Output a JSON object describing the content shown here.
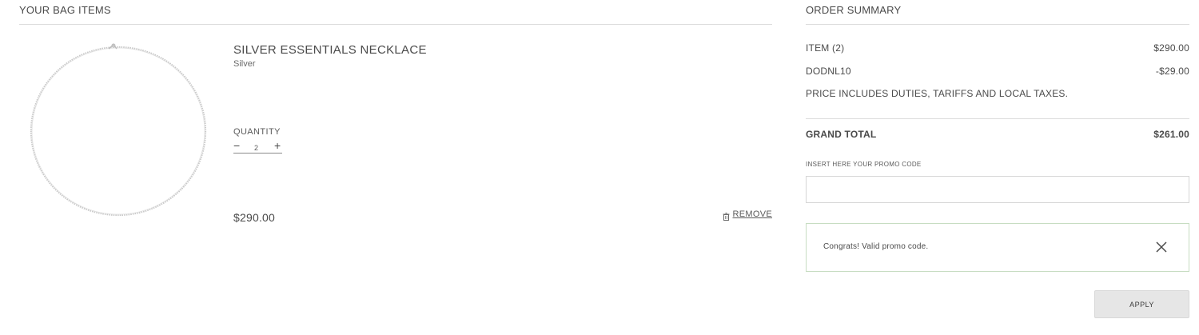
{
  "bag": {
    "title": "YOUR BAG ITEMS",
    "item": {
      "image_icon": "necklace-chain-icon",
      "name": "SILVER ESSENTIALS NECKLACE",
      "variant": "Silver",
      "quantity_label": "QUANTITY",
      "quantity_minus": "−",
      "quantity_plus": "+",
      "quantity": "2",
      "price": "$290.00",
      "remove_icon": "trash-icon",
      "remove_label": "REMOVE"
    }
  },
  "summary": {
    "title": "ORDER SUMMARY",
    "items_label": "ITEM (2)",
    "items_value": "$290.00",
    "discount_label": "DODNL10",
    "discount_value": "-$29.00",
    "tax_note": "PRICE INCLUDES DUTIES, TARIFFS AND LOCAL TAXES.",
    "grand_total_label": "GRAND TOTAL",
    "grand_total_value": "$261.00",
    "promo_label": "INSERT HERE YOUR PROMO CODE",
    "promo_value": "",
    "promo_placeholder": "",
    "alert_text": "Congrats! Valid promo code.",
    "close_icon": "close-icon",
    "apply_label": "APPLY"
  },
  "colors": {
    "text": "#4a4a4a",
    "divider": "#dcdcdc",
    "alert_border": "#c7ddc2",
    "button_bg": "#e6e6e6"
  }
}
